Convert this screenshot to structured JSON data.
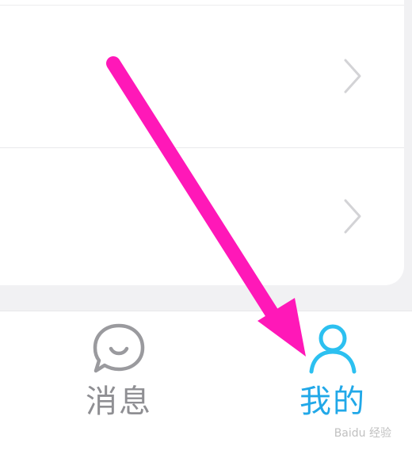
{
  "list": {
    "rows": [
      {
        "chevron_icon": "chevron-right-icon"
      },
      {
        "chevron_icon": "chevron-right-icon"
      }
    ]
  },
  "tabbar": {
    "tabs": [
      {
        "label": "消息",
        "icon": "chat-bubble-icon",
        "active": false
      },
      {
        "label": "我的",
        "icon": "person-icon",
        "active": true
      }
    ],
    "active_color": "#21a8e8",
    "inactive_color": "#8f8f93"
  },
  "annotation": {
    "arrow_color": "#ff18b8"
  },
  "watermark": {
    "text": "Baidu 经验"
  }
}
